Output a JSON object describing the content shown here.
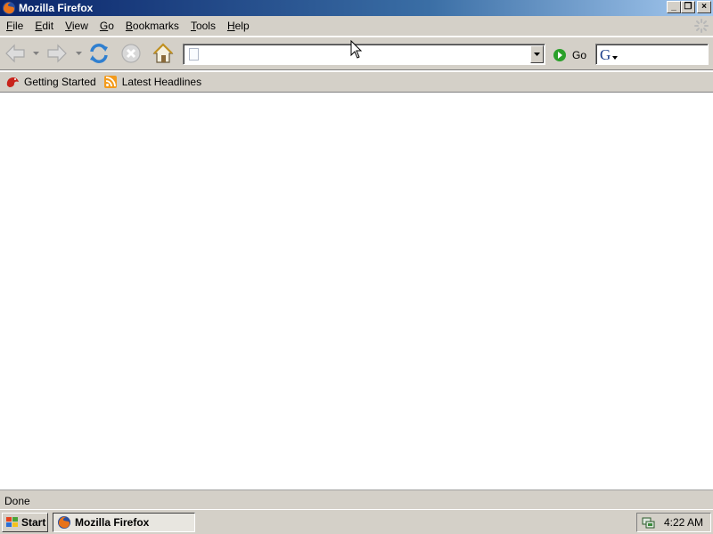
{
  "window": {
    "title": "Mozilla Firefox",
    "controls": {
      "minimize": "_",
      "restore": "❐",
      "close": "×"
    }
  },
  "menu": [
    {
      "label": "File",
      "key": "F",
      "rest": "ile"
    },
    {
      "label": "Edit",
      "key": "E",
      "rest": "dit"
    },
    {
      "label": "View",
      "key": "V",
      "rest": "iew"
    },
    {
      "label": "Go",
      "key": "G",
      "rest": "o"
    },
    {
      "label": "Bookmarks",
      "key": "B",
      "rest": "ookmarks"
    },
    {
      "label": "Tools",
      "key": "T",
      "rest": "ools"
    },
    {
      "label": "Help",
      "key": "H",
      "rest": "elp"
    }
  ],
  "toolbar": {
    "icons": [
      "back-arrow-icon",
      "forward-arrow-icon",
      "reload-icon",
      "stop-icon",
      "home-icon"
    ],
    "address_value": "",
    "go_label": "Go",
    "search_engine_letter": "G",
    "search_value": ""
  },
  "bookmarks": {
    "items": [
      {
        "label": "Getting Started",
        "icon": "firefox-bookmark-icon"
      },
      {
        "label": "Latest Headlines",
        "icon": "rss-feed-icon"
      }
    ]
  },
  "status": {
    "text": "Done"
  },
  "taskbar": {
    "start_label": "Start",
    "task_label": "Mozilla Firefox",
    "clock": "4:22 AM"
  },
  "colors": {
    "titlebar_start": "#0a246a",
    "titlebar_end": "#a6caf0",
    "chrome": "#d4d0c8",
    "go_green": "#2aa02a"
  }
}
